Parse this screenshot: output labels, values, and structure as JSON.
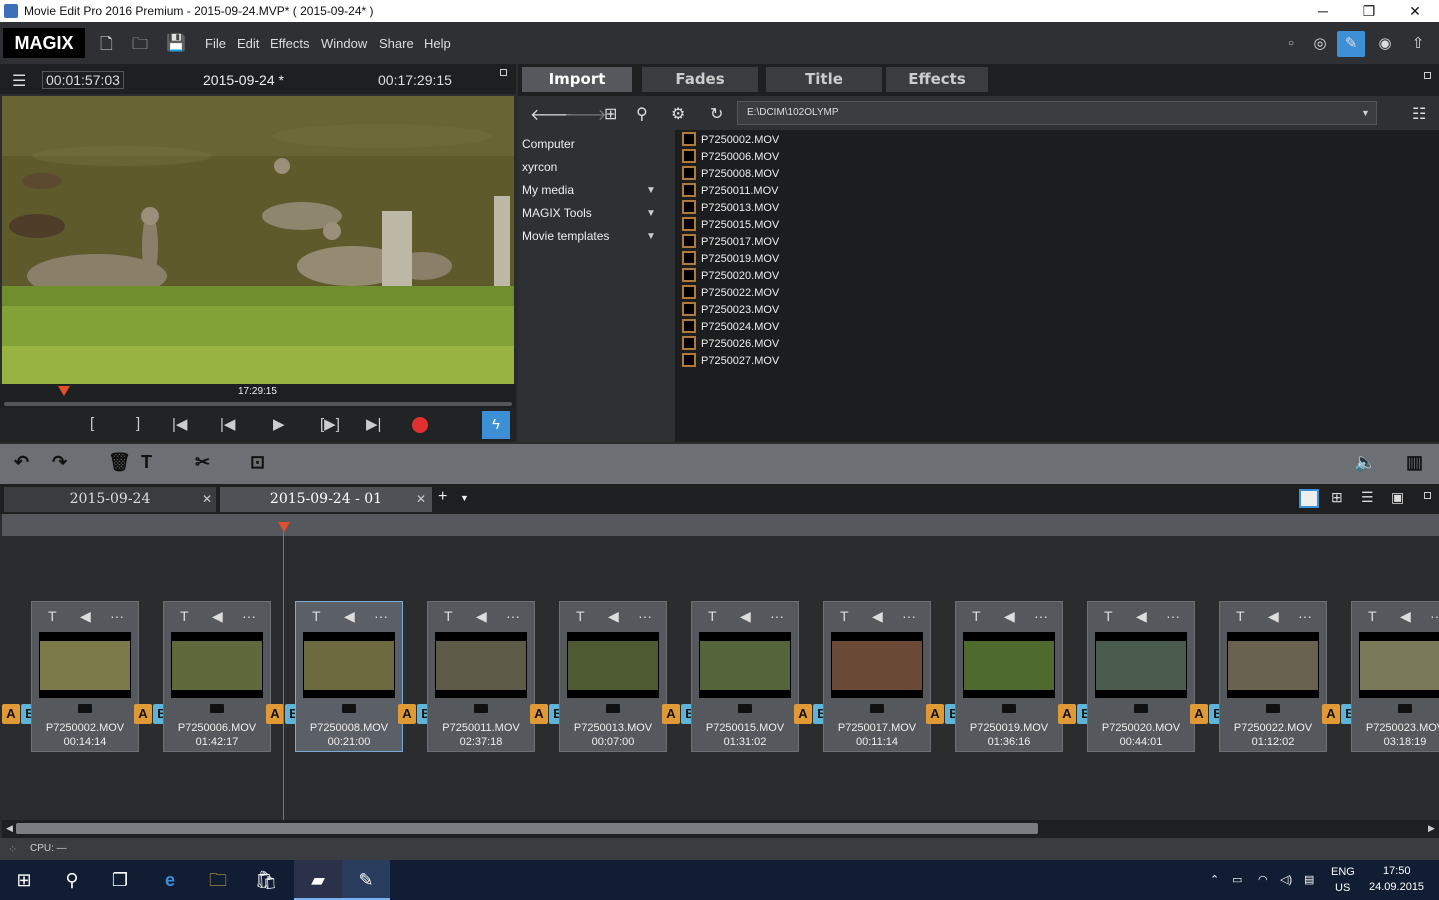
{
  "window": {
    "title": "Movie Edit Pro 2016 Premium - 2015-09-24.MVP* ( 2015-09-24* )",
    "minimize": "─",
    "maximize": "❐",
    "close": "✕"
  },
  "app": {
    "logo": "MAGIX"
  },
  "menu": [
    "File",
    "Edit",
    "Effects",
    "Window",
    "Share",
    "Help"
  ],
  "preview": {
    "timecode": "00:01:57:03",
    "project": "2015-09-24 *",
    "total": "00:17:29:15",
    "scrub_time": "17:29:15"
  },
  "media": {
    "tabs": [
      "Import",
      "Fades",
      "Title",
      "Effects"
    ],
    "path": "E:\\DCIM\\102OLYMP",
    "tree": [
      "Computer",
      "xyrcon",
      "My media",
      "MAGIX Tools",
      "Movie templates"
    ],
    "files": [
      "P7250002.MOV",
      "P7250006.MOV",
      "P7250008.MOV",
      "P7250011.MOV",
      "P7250013.MOV",
      "P7250015.MOV",
      "P7250017.MOV",
      "P7250019.MOV",
      "P7250020.MOV",
      "P7250022.MOV",
      "P7250023.MOV",
      "P7250024.MOV",
      "P7250026.MOV",
      "P7250027.MOV"
    ]
  },
  "project_tabs": [
    "2015-09-24",
    "2015-09-24 - 01"
  ],
  "clips": [
    {
      "name": "P7250002.MOV",
      "duration": "00:14:14",
      "thumb_color": "#7b7a4a"
    },
    {
      "name": "P7250006.MOV",
      "duration": "01:42:17",
      "thumb_color": "#5f6a3c"
    },
    {
      "name": "P7250008.MOV",
      "duration": "00:21:00",
      "thumb_color": "#6d6a40"
    },
    {
      "name": "P7250011.MOV",
      "duration": "02:37:18",
      "thumb_color": "#5d5a48"
    },
    {
      "name": "P7250013.MOV",
      "duration": "00:07:00",
      "thumb_color": "#4d5a32"
    },
    {
      "name": "P7250015.MOV",
      "duration": "01:31:02",
      "thumb_color": "#55643a"
    },
    {
      "name": "P7250017.MOV",
      "duration": "00:11:14",
      "thumb_color": "#6a4a36"
    },
    {
      "name": "P7250019.MOV",
      "duration": "01:36:16",
      "thumb_color": "#4e6a2e"
    },
    {
      "name": "P7250020.MOV",
      "duration": "00:44:01",
      "thumb_color": "#4a5c4e"
    },
    {
      "name": "P7250022.MOV",
      "duration": "01:12:02",
      "thumb_color": "#6a6250"
    },
    {
      "name": "P7250023.MOV",
      "duration": "03:18:19",
      "thumb_color": "#7a7a5a"
    }
  ],
  "status": {
    "cpu": "CPU: —"
  },
  "taskbar": {
    "lang": "ENG",
    "region": "US",
    "time": "17:50",
    "date": "24.09.2015"
  },
  "colors": {
    "accent": "#3d8fd6",
    "record": "#e03030",
    "playhead": "#e0502a",
    "a_marker": "#e09a35",
    "b_marker": "#5fb3d6"
  }
}
